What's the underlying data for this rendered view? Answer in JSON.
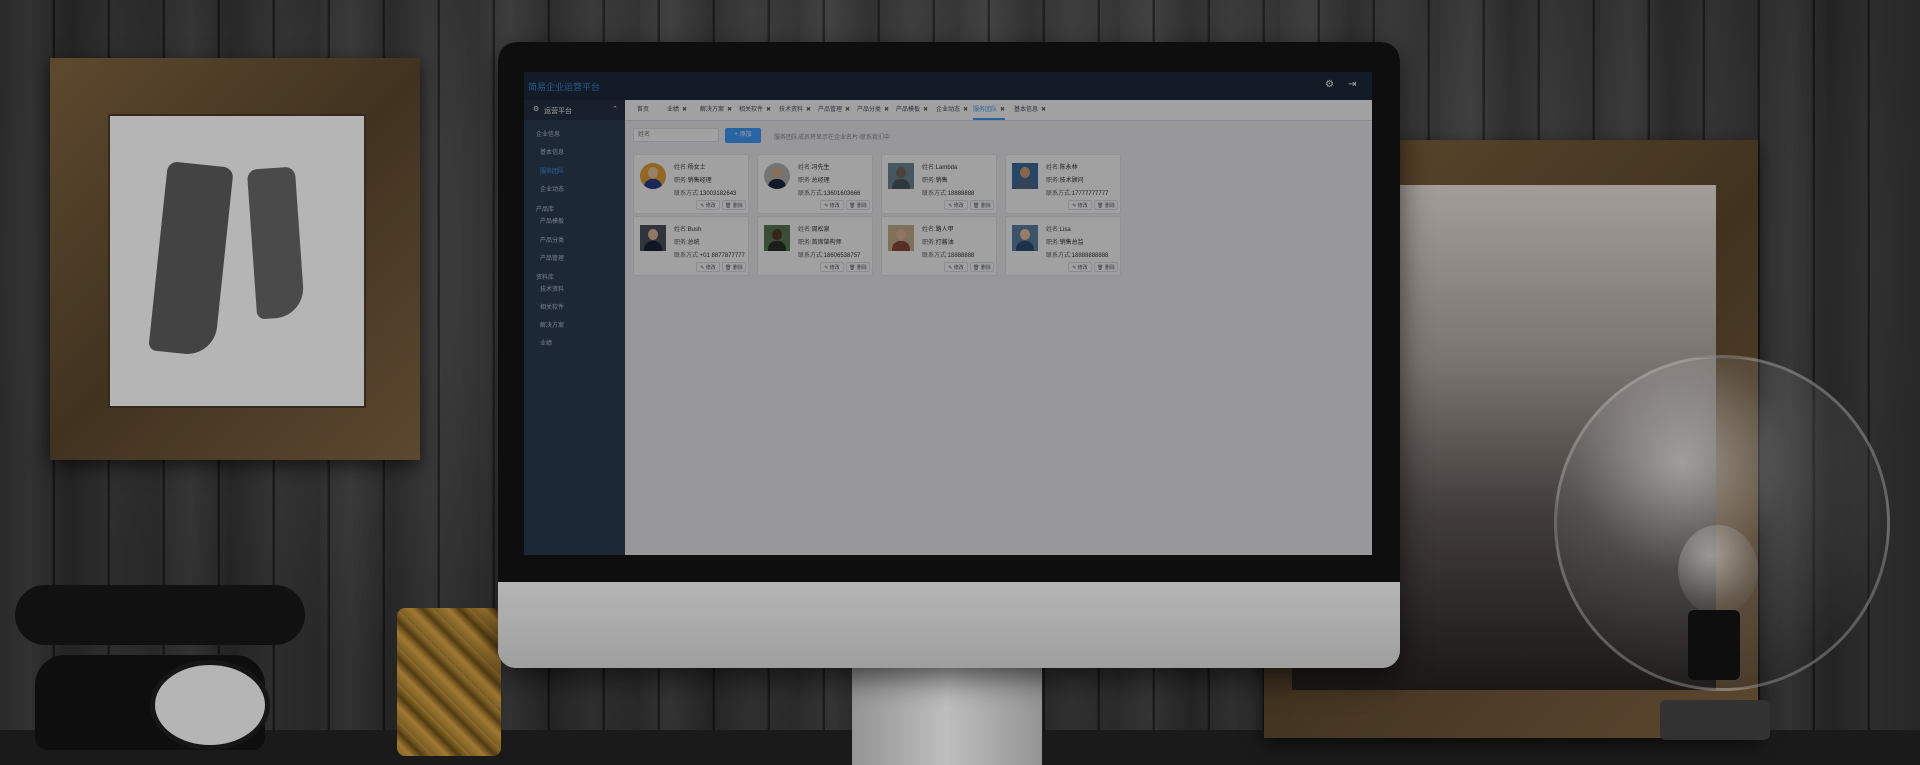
{
  "app": {
    "title": "简易企业运营平台"
  },
  "header": {
    "settings_icon": "gear-icon",
    "logout_icon": "logout-icon"
  },
  "sidebar": {
    "title": "运营平台",
    "groups": [
      {
        "label": "企业信息",
        "items": [
          "基本信息",
          "服务团队",
          "企业动态"
        ]
      },
      {
        "label": "产品库",
        "items": [
          "产品模板",
          "产品分类",
          "产品管理"
        ]
      },
      {
        "label": "资料库",
        "items": [
          "技术资料",
          "相关软件",
          "解决方案",
          "业绩"
        ]
      }
    ],
    "active_item": "服务团队"
  },
  "tabs": [
    {
      "label": "首页",
      "closable": false
    },
    {
      "label": "业绩",
      "closable": true
    },
    {
      "label": "解决方案",
      "closable": true
    },
    {
      "label": "相关软件",
      "closable": true
    },
    {
      "label": "技术资料",
      "closable": true
    },
    {
      "label": "产品管理",
      "closable": true
    },
    {
      "label": "产品分类",
      "closable": true
    },
    {
      "label": "产品模板",
      "closable": true
    },
    {
      "label": "企业动态",
      "closable": true
    },
    {
      "label": "服务团队",
      "closable": true,
      "active": true
    },
    {
      "label": "基本信息",
      "closable": true
    }
  ],
  "toolbar": {
    "search_placeholder": "姓名",
    "add_label": "+ 添加",
    "hint": "服务团队成员将显示在企业名片-联系我们中"
  },
  "labels": {
    "name": "姓名:",
    "position": "职务:",
    "contact": "联系方式:",
    "edit": "✎ 修改",
    "delete": "🗑 删除"
  },
  "members": [
    {
      "name": "杨女士",
      "position": "销售经理",
      "contact": "13003182643"
    },
    {
      "name": "冯先生",
      "position": "总经理",
      "contact": "13601603666"
    },
    {
      "name": "Lambda",
      "position": "销售",
      "contact": "18888888"
    },
    {
      "name": "陈永林",
      "position": "技术顾问",
      "contact": "17777777777"
    },
    {
      "name": "Bush",
      "position": "总统",
      "contact": "+01 8877877777"
    },
    {
      "name": "周松泉",
      "position": "首席架构师",
      "contact": "18606538757"
    },
    {
      "name": "路人甲",
      "position": "打酱油",
      "contact": "18888888"
    },
    {
      "name": "Lisa",
      "position": "销售总监",
      "contact": "18888888888"
    }
  ],
  "colors": {
    "accent": "#409eff",
    "sidebar": "#304156",
    "topbar": "#1f2d3d"
  }
}
